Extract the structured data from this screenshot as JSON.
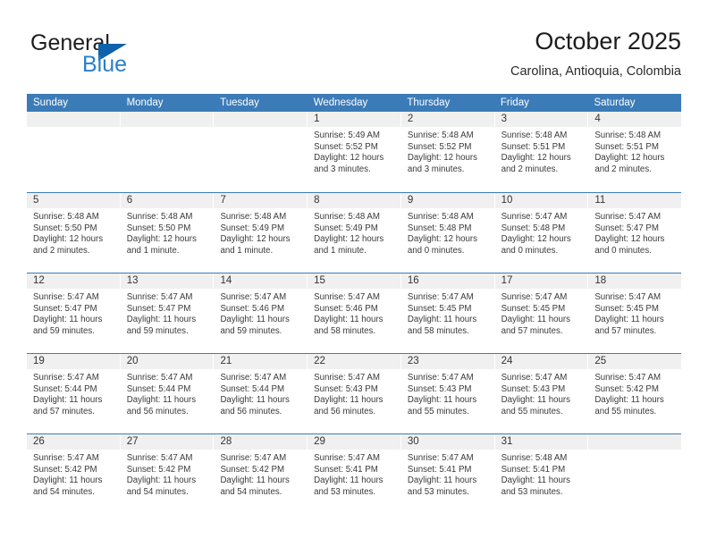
{
  "brand": {
    "word1": "General",
    "word2": "Blue",
    "triangle_color": "#0f62ab",
    "blue_text_color": "#2a7fc9"
  },
  "header": {
    "title": "October 2025",
    "location": "Carolina, Antioquia, Colombia"
  },
  "theme": {
    "header_blue": "#3b7cb8",
    "day_band_gray": "#f0f0f0",
    "text_color": "#333333"
  },
  "calendar": {
    "weekdays": [
      "Sunday",
      "Monday",
      "Tuesday",
      "Wednesday",
      "Thursday",
      "Friday",
      "Saturday"
    ],
    "weeks": [
      [
        {
          "day": "",
          "empty": true,
          "sunrise": "",
          "sunset": "",
          "daylight1": "",
          "daylight2": ""
        },
        {
          "day": "",
          "empty": true,
          "sunrise": "",
          "sunset": "",
          "daylight1": "",
          "daylight2": ""
        },
        {
          "day": "",
          "empty": true,
          "sunrise": "",
          "sunset": "",
          "daylight1": "",
          "daylight2": ""
        },
        {
          "day": "1",
          "empty": false,
          "sunrise": "Sunrise: 5:49 AM",
          "sunset": "Sunset: 5:52 PM",
          "daylight1": "Daylight: 12 hours",
          "daylight2": "and 3 minutes."
        },
        {
          "day": "2",
          "empty": false,
          "sunrise": "Sunrise: 5:48 AM",
          "sunset": "Sunset: 5:52 PM",
          "daylight1": "Daylight: 12 hours",
          "daylight2": "and 3 minutes."
        },
        {
          "day": "3",
          "empty": false,
          "sunrise": "Sunrise: 5:48 AM",
          "sunset": "Sunset: 5:51 PM",
          "daylight1": "Daylight: 12 hours",
          "daylight2": "and 2 minutes."
        },
        {
          "day": "4",
          "empty": false,
          "sunrise": "Sunrise: 5:48 AM",
          "sunset": "Sunset: 5:51 PM",
          "daylight1": "Daylight: 12 hours",
          "daylight2": "and 2 minutes."
        }
      ],
      [
        {
          "day": "5",
          "empty": false,
          "sunrise": "Sunrise: 5:48 AM",
          "sunset": "Sunset: 5:50 PM",
          "daylight1": "Daylight: 12 hours",
          "daylight2": "and 2 minutes."
        },
        {
          "day": "6",
          "empty": false,
          "sunrise": "Sunrise: 5:48 AM",
          "sunset": "Sunset: 5:50 PM",
          "daylight1": "Daylight: 12 hours",
          "daylight2": "and 1 minute."
        },
        {
          "day": "7",
          "empty": false,
          "sunrise": "Sunrise: 5:48 AM",
          "sunset": "Sunset: 5:49 PM",
          "daylight1": "Daylight: 12 hours",
          "daylight2": "and 1 minute."
        },
        {
          "day": "8",
          "empty": false,
          "sunrise": "Sunrise: 5:48 AM",
          "sunset": "Sunset: 5:49 PM",
          "daylight1": "Daylight: 12 hours",
          "daylight2": "and 1 minute."
        },
        {
          "day": "9",
          "empty": false,
          "sunrise": "Sunrise: 5:48 AM",
          "sunset": "Sunset: 5:48 PM",
          "daylight1": "Daylight: 12 hours",
          "daylight2": "and 0 minutes."
        },
        {
          "day": "10",
          "empty": false,
          "sunrise": "Sunrise: 5:47 AM",
          "sunset": "Sunset: 5:48 PM",
          "daylight1": "Daylight: 12 hours",
          "daylight2": "and 0 minutes."
        },
        {
          "day": "11",
          "empty": false,
          "sunrise": "Sunrise: 5:47 AM",
          "sunset": "Sunset: 5:47 PM",
          "daylight1": "Daylight: 12 hours",
          "daylight2": "and 0 minutes."
        }
      ],
      [
        {
          "day": "12",
          "empty": false,
          "sunrise": "Sunrise: 5:47 AM",
          "sunset": "Sunset: 5:47 PM",
          "daylight1": "Daylight: 11 hours",
          "daylight2": "and 59 minutes."
        },
        {
          "day": "13",
          "empty": false,
          "sunrise": "Sunrise: 5:47 AM",
          "sunset": "Sunset: 5:47 PM",
          "daylight1": "Daylight: 11 hours",
          "daylight2": "and 59 minutes."
        },
        {
          "day": "14",
          "empty": false,
          "sunrise": "Sunrise: 5:47 AM",
          "sunset": "Sunset: 5:46 PM",
          "daylight1": "Daylight: 11 hours",
          "daylight2": "and 59 minutes."
        },
        {
          "day": "15",
          "empty": false,
          "sunrise": "Sunrise: 5:47 AM",
          "sunset": "Sunset: 5:46 PM",
          "daylight1": "Daylight: 11 hours",
          "daylight2": "and 58 minutes."
        },
        {
          "day": "16",
          "empty": false,
          "sunrise": "Sunrise: 5:47 AM",
          "sunset": "Sunset: 5:45 PM",
          "daylight1": "Daylight: 11 hours",
          "daylight2": "and 58 minutes."
        },
        {
          "day": "17",
          "empty": false,
          "sunrise": "Sunrise: 5:47 AM",
          "sunset": "Sunset: 5:45 PM",
          "daylight1": "Daylight: 11 hours",
          "daylight2": "and 57 minutes."
        },
        {
          "day": "18",
          "empty": false,
          "sunrise": "Sunrise: 5:47 AM",
          "sunset": "Sunset: 5:45 PM",
          "daylight1": "Daylight: 11 hours",
          "daylight2": "and 57 minutes."
        }
      ],
      [
        {
          "day": "19",
          "empty": false,
          "sunrise": "Sunrise: 5:47 AM",
          "sunset": "Sunset: 5:44 PM",
          "daylight1": "Daylight: 11 hours",
          "daylight2": "and 57 minutes."
        },
        {
          "day": "20",
          "empty": false,
          "sunrise": "Sunrise: 5:47 AM",
          "sunset": "Sunset: 5:44 PM",
          "daylight1": "Daylight: 11 hours",
          "daylight2": "and 56 minutes."
        },
        {
          "day": "21",
          "empty": false,
          "sunrise": "Sunrise: 5:47 AM",
          "sunset": "Sunset: 5:44 PM",
          "daylight1": "Daylight: 11 hours",
          "daylight2": "and 56 minutes."
        },
        {
          "day": "22",
          "empty": false,
          "sunrise": "Sunrise: 5:47 AM",
          "sunset": "Sunset: 5:43 PM",
          "daylight1": "Daylight: 11 hours",
          "daylight2": "and 56 minutes."
        },
        {
          "day": "23",
          "empty": false,
          "sunrise": "Sunrise: 5:47 AM",
          "sunset": "Sunset: 5:43 PM",
          "daylight1": "Daylight: 11 hours",
          "daylight2": "and 55 minutes."
        },
        {
          "day": "24",
          "empty": false,
          "sunrise": "Sunrise: 5:47 AM",
          "sunset": "Sunset: 5:43 PM",
          "daylight1": "Daylight: 11 hours",
          "daylight2": "and 55 minutes."
        },
        {
          "day": "25",
          "empty": false,
          "sunrise": "Sunrise: 5:47 AM",
          "sunset": "Sunset: 5:42 PM",
          "daylight1": "Daylight: 11 hours",
          "daylight2": "and 55 minutes."
        }
      ],
      [
        {
          "day": "26",
          "empty": false,
          "sunrise": "Sunrise: 5:47 AM",
          "sunset": "Sunset: 5:42 PM",
          "daylight1": "Daylight: 11 hours",
          "daylight2": "and 54 minutes."
        },
        {
          "day": "27",
          "empty": false,
          "sunrise": "Sunrise: 5:47 AM",
          "sunset": "Sunset: 5:42 PM",
          "daylight1": "Daylight: 11 hours",
          "daylight2": "and 54 minutes."
        },
        {
          "day": "28",
          "empty": false,
          "sunrise": "Sunrise: 5:47 AM",
          "sunset": "Sunset: 5:42 PM",
          "daylight1": "Daylight: 11 hours",
          "daylight2": "and 54 minutes."
        },
        {
          "day": "29",
          "empty": false,
          "sunrise": "Sunrise: 5:47 AM",
          "sunset": "Sunset: 5:41 PM",
          "daylight1": "Daylight: 11 hours",
          "daylight2": "and 53 minutes."
        },
        {
          "day": "30",
          "empty": false,
          "sunrise": "Sunrise: 5:47 AM",
          "sunset": "Sunset: 5:41 PM",
          "daylight1": "Daylight: 11 hours",
          "daylight2": "and 53 minutes."
        },
        {
          "day": "31",
          "empty": false,
          "sunrise": "Sunrise: 5:48 AM",
          "sunset": "Sunset: 5:41 PM",
          "daylight1": "Daylight: 11 hours",
          "daylight2": "and 53 minutes."
        },
        {
          "day": "",
          "empty": true,
          "sunrise": "",
          "sunset": "",
          "daylight1": "",
          "daylight2": ""
        }
      ]
    ]
  }
}
